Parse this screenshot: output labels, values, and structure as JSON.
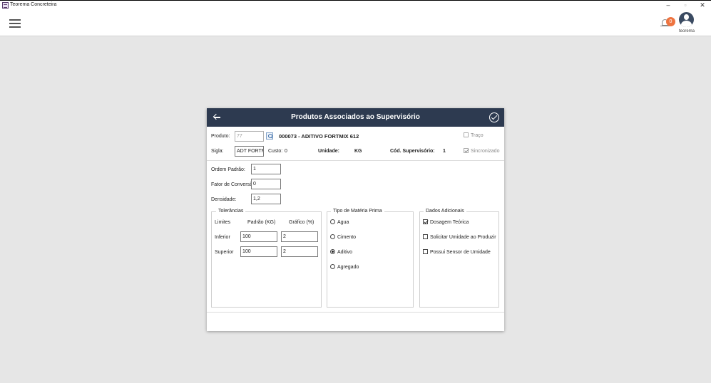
{
  "window": {
    "title": "Teorema Concreteira",
    "minimize": "–",
    "maximize": "▫",
    "close": "✕"
  },
  "appbar": {
    "notification_count": "0",
    "username": "teorema"
  },
  "dialog": {
    "title": "Produtos Associados ao Supervisório",
    "produto_label": "Produto:",
    "produto_placeholder": "77",
    "produto_name": "000073 - ADITIVO FORTMIX 612",
    "traco_label": "Traço",
    "traco_checked": false,
    "sigla_label": "Sigla:",
    "sigla_value": "ADT FORTMI",
    "custo_label": "Custo:",
    "custo_value": "0",
    "unidade_label": "Unidade:",
    "unidade_value": "KG",
    "cod_label": "Cód. Supervisório:",
    "cod_value": "1",
    "sincronizado_label": "Sincronizado",
    "sincronizado_checked": true,
    "ordem_label": "Ordem Padrão:",
    "ordem_value": "1",
    "fator_label": "Fator de Conversão:",
    "fator_value": "0",
    "densidade_label": "Densidade:",
    "densidade_value": "1,2",
    "tolerancias": {
      "legend": "Tolerâncias",
      "col_limites": "Limites",
      "col_padrao": "Padrão (KG)",
      "col_grafico": "Gráfico (%)",
      "rows": [
        {
          "label": "Inferior",
          "padrao": "100",
          "grafico": "2"
        },
        {
          "label": "Superior",
          "padrao": "100",
          "grafico": "2"
        }
      ]
    },
    "tipo": {
      "legend": "Tipo de Matéria Prima",
      "options": [
        "Agua",
        "Cimento",
        "Aditivo",
        "Agregado"
      ],
      "selected": "Aditivo"
    },
    "adicionais": {
      "legend": "Dados Adicionais",
      "items": [
        {
          "label": "Dosagem Teórica",
          "checked": true
        },
        {
          "label": "Solicitar Umidade ao Produzir",
          "checked": false
        },
        {
          "label": "Possui Sensor de Umidade",
          "checked": false
        }
      ]
    }
  }
}
